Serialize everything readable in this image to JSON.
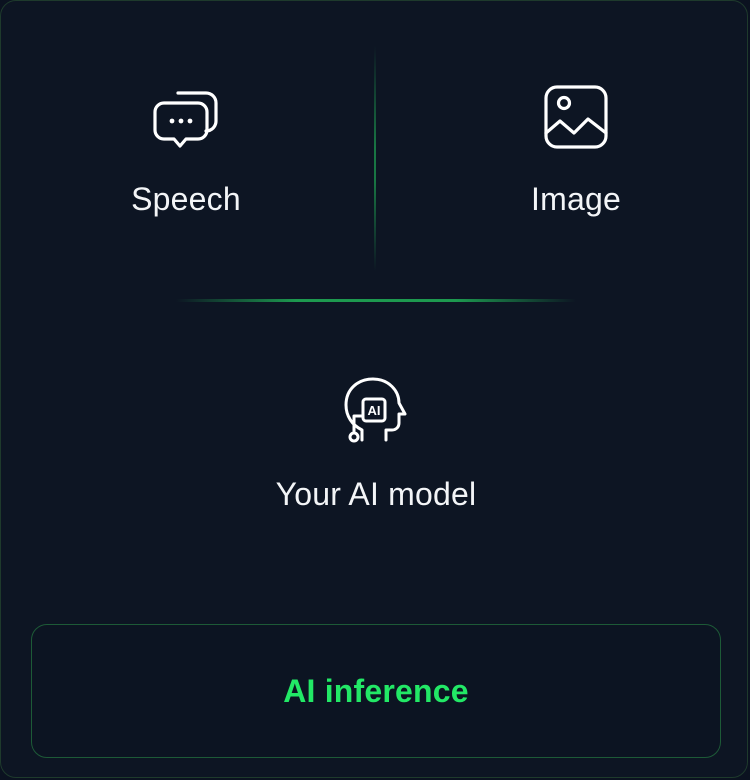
{
  "inputs": [
    {
      "label": "Speech",
      "icon": "chat-bubbles-icon"
    },
    {
      "label": "Image",
      "icon": "image-icon"
    }
  ],
  "model": {
    "label": "Your AI model",
    "icon": "ai-head-icon",
    "icon_text": "AI"
  },
  "inference": {
    "label": "AI inference"
  },
  "colors": {
    "background": "#0d1523",
    "accent": "#22e866",
    "divider": "#22c55e",
    "text": "#f3f5f7"
  }
}
